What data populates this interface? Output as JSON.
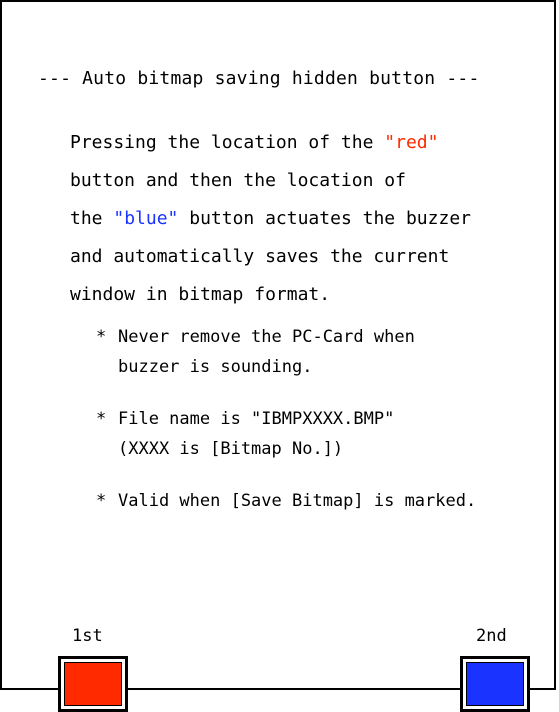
{
  "title": "--- Auto bitmap saving hidden button ---",
  "description": {
    "line1_prefix": "Pressing the location of the ",
    "red_word": "\"red\"",
    "line2": "button and then the location of",
    "line3_prefix": "the ",
    "blue_word": "\"blue\"",
    "line3_suffix": " button actuates the buzzer",
    "line4": "and automatically saves the current",
    "line5": "window in bitmap format."
  },
  "notes": [
    {
      "bullet": "*",
      "lines": [
        "Never remove the PC-Card when",
        "buzzer is sounding."
      ]
    },
    {
      "bullet": "*",
      "lines": [
        "File name is \"IBMPXXXX.BMP\"",
        "(XXXX is [Bitmap No.])"
      ]
    },
    {
      "bullet": "*",
      "lines": [
        "Valid when [Save Bitmap] is marked."
      ]
    }
  ],
  "buttons": {
    "first_label": "1st",
    "second_label": "2nd",
    "first_color": "#ff2a00",
    "second_color": "#1a33ff"
  }
}
